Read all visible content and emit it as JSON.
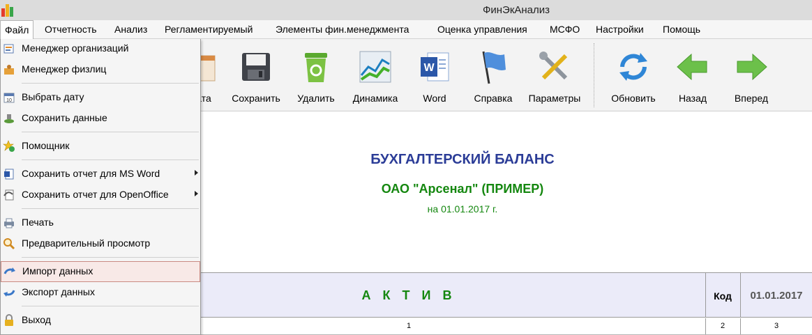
{
  "window": {
    "title": "ФинЭкАнализ"
  },
  "menubar": [
    "Файл",
    "Отчетность",
    "Анализ",
    "Регламентируемый",
    "Элементы фин.менеджмента",
    "Оценка управления",
    "МСФО",
    "Настройки",
    "Помощь"
  ],
  "toolbar": {
    "partial_label": "ата",
    "save": "Сохранить",
    "delete": "Удалить",
    "dynamics": "Динамика",
    "word": "Word",
    "help": "Справка",
    "params": "Параметры",
    "refresh": "Обновить",
    "back": "Назад",
    "forward": "Вперед"
  },
  "file_menu": {
    "items": [
      {
        "label": "Менеджер организаций",
        "icon": "organizations-icon"
      },
      {
        "label": "Менеджер физлиц",
        "icon": "persons-icon"
      },
      {
        "label": "Выбрать дату",
        "icon": "calendar-icon"
      },
      {
        "label": "Сохранить данные",
        "icon": "save-data-icon"
      },
      {
        "label": "Помощник",
        "icon": "wizard-icon"
      },
      {
        "label": "Сохранить отчет для MS Word",
        "icon": "word-doc-icon",
        "submenu": true
      },
      {
        "label": "Сохранить отчет для OpenOffice",
        "icon": "openoffice-icon",
        "submenu": true
      },
      {
        "label": "Печать",
        "icon": "printer-icon"
      },
      {
        "label": "Предварительный просмотр",
        "icon": "magnifier-icon"
      },
      {
        "label": "Импорт данных",
        "icon": "import-icon",
        "highlighted": true
      },
      {
        "label": "Экспорт данных",
        "icon": "export-icon"
      },
      {
        "label": "Выход",
        "icon": "exit-icon"
      }
    ]
  },
  "report": {
    "title": "БУХГАЛТЕРСКИЙ БАЛАНС",
    "organization": "ОАО \"Арсенал\" (ПРИМЕР)",
    "date": "на 01.01.2017 г.",
    "columns": {
      "aktiv": "А К Т И В",
      "kod": "Код",
      "date": "01.01.2017"
    },
    "column_numbers": [
      "1",
      "2",
      "3"
    ]
  },
  "colors": {
    "title_blue": "#2b3c97",
    "green": "#14870f",
    "menu_highlight": "#f8e9e7"
  }
}
